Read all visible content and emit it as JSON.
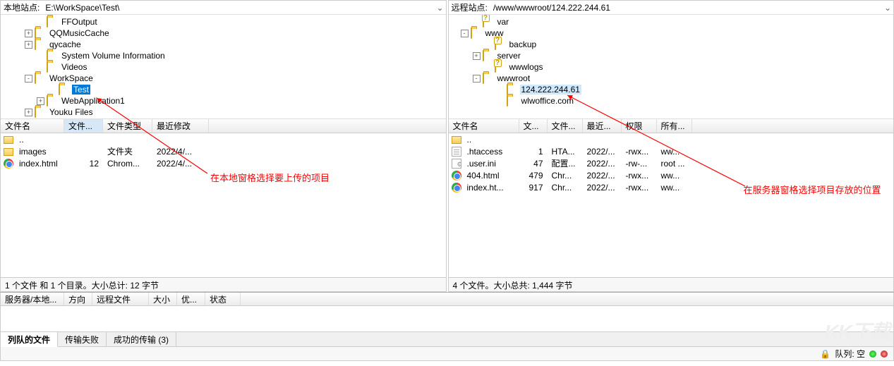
{
  "local": {
    "path_label": "本地站点:",
    "path_value": "E:\\WorkSpace\\Test\\",
    "tree": [
      {
        "indent": 3,
        "toggle": "",
        "icon": "folder",
        "label": "FFOutput"
      },
      {
        "indent": 2,
        "toggle": "+",
        "icon": "folder",
        "label": "QQMusicCache"
      },
      {
        "indent": 2,
        "toggle": "+",
        "icon": "folder",
        "label": "qycache"
      },
      {
        "indent": 3,
        "toggle": "",
        "icon": "folder",
        "label": "System Volume Information"
      },
      {
        "indent": 3,
        "toggle": "",
        "icon": "folder",
        "label": "Videos"
      },
      {
        "indent": 2,
        "toggle": "-",
        "icon": "folder",
        "label": "WorkSpace"
      },
      {
        "indent": 4,
        "toggle": "",
        "icon": "folder",
        "label": "Test",
        "selected": true
      },
      {
        "indent": 3,
        "toggle": "+",
        "icon": "folder",
        "label": "WebApplication1"
      },
      {
        "indent": 2,
        "toggle": "+",
        "icon": "folder",
        "label": "Youku Files"
      }
    ],
    "list_cols": [
      "文件名",
      "文件...",
      "文件类型",
      "最近修改"
    ],
    "list_col_w": [
      90,
      55,
      70,
      80
    ],
    "list_sel_col": 1,
    "rows": [
      {
        "icon": "folder-ic",
        "cells": [
          "..",
          "",
          "",
          ""
        ]
      },
      {
        "icon": "folder-ic",
        "cells": [
          "images",
          "",
          "文件夹",
          "2022/4/..."
        ]
      },
      {
        "icon": "chrome",
        "cells": [
          "index.html",
          "12",
          "Chrom...",
          "2022/4/..."
        ]
      }
    ],
    "status": "1 个文件 和 1 个目录。大小总计: 12 字节",
    "annotation": "在本地窗格选择要上传的项目"
  },
  "remote": {
    "path_label": "远程站点:",
    "path_value": "/www/wwwroot/124.222.244.61",
    "tree": [
      {
        "indent": 2,
        "toggle": "",
        "icon": "folder-q",
        "label": "var"
      },
      {
        "indent": 1,
        "toggle": "-",
        "icon": "folder",
        "label": "www"
      },
      {
        "indent": 3,
        "toggle": "",
        "icon": "folder-q",
        "label": "backup"
      },
      {
        "indent": 2,
        "toggle": "+",
        "icon": "folder",
        "label": "server"
      },
      {
        "indent": 3,
        "toggle": "",
        "icon": "folder-q",
        "label": "wwwlogs"
      },
      {
        "indent": 2,
        "toggle": "-",
        "icon": "folder",
        "label": "wwwroot"
      },
      {
        "indent": 4,
        "toggle": "",
        "icon": "folder",
        "label": "124.222.244.61",
        "selected2": true
      },
      {
        "indent": 4,
        "toggle": "",
        "icon": "folder",
        "label": "wlwoffice.com"
      }
    ],
    "list_cols": [
      "文件名",
      "文...",
      "文件...",
      "最近...",
      "权限",
      "所有..."
    ],
    "list_col_w": [
      100,
      40,
      50,
      55,
      50,
      50
    ],
    "rows": [
      {
        "icon": "folder-ic",
        "cells": [
          "..",
          "",
          "",
          "",
          "",
          ""
        ]
      },
      {
        "icon": "txt",
        "cells": [
          ".htaccess",
          "1",
          "HTA...",
          "2022/...",
          "-rwx...",
          "ww..."
        ]
      },
      {
        "icon": "cfg",
        "cells": [
          ".user.ini",
          "47",
          "配置...",
          "2022/...",
          "-rw-...",
          "root ..."
        ]
      },
      {
        "icon": "chrome",
        "cells": [
          "404.html",
          "479",
          "Chr...",
          "2022/...",
          "-rwx...",
          "ww..."
        ]
      },
      {
        "icon": "chrome",
        "cells": [
          "index.ht...",
          "917",
          "Chr...",
          "2022/...",
          "-rwx...",
          "ww..."
        ]
      }
    ],
    "status": "4 个文件。大小总共: 1,444 字节",
    "annotation": "在服务器窗格选择项目存放的位置"
  },
  "transfer_cols": [
    "服务器/本地...",
    "方向",
    "远程文件",
    "大小",
    "优...",
    "状态"
  ],
  "tabs": [
    {
      "label": "列队的文件",
      "active": true
    },
    {
      "label": "传输失败",
      "active": false
    },
    {
      "label": "成功的传输 (3)",
      "active": false
    }
  ],
  "queue_label": "队列: 空",
  "watermark": "KK下载"
}
